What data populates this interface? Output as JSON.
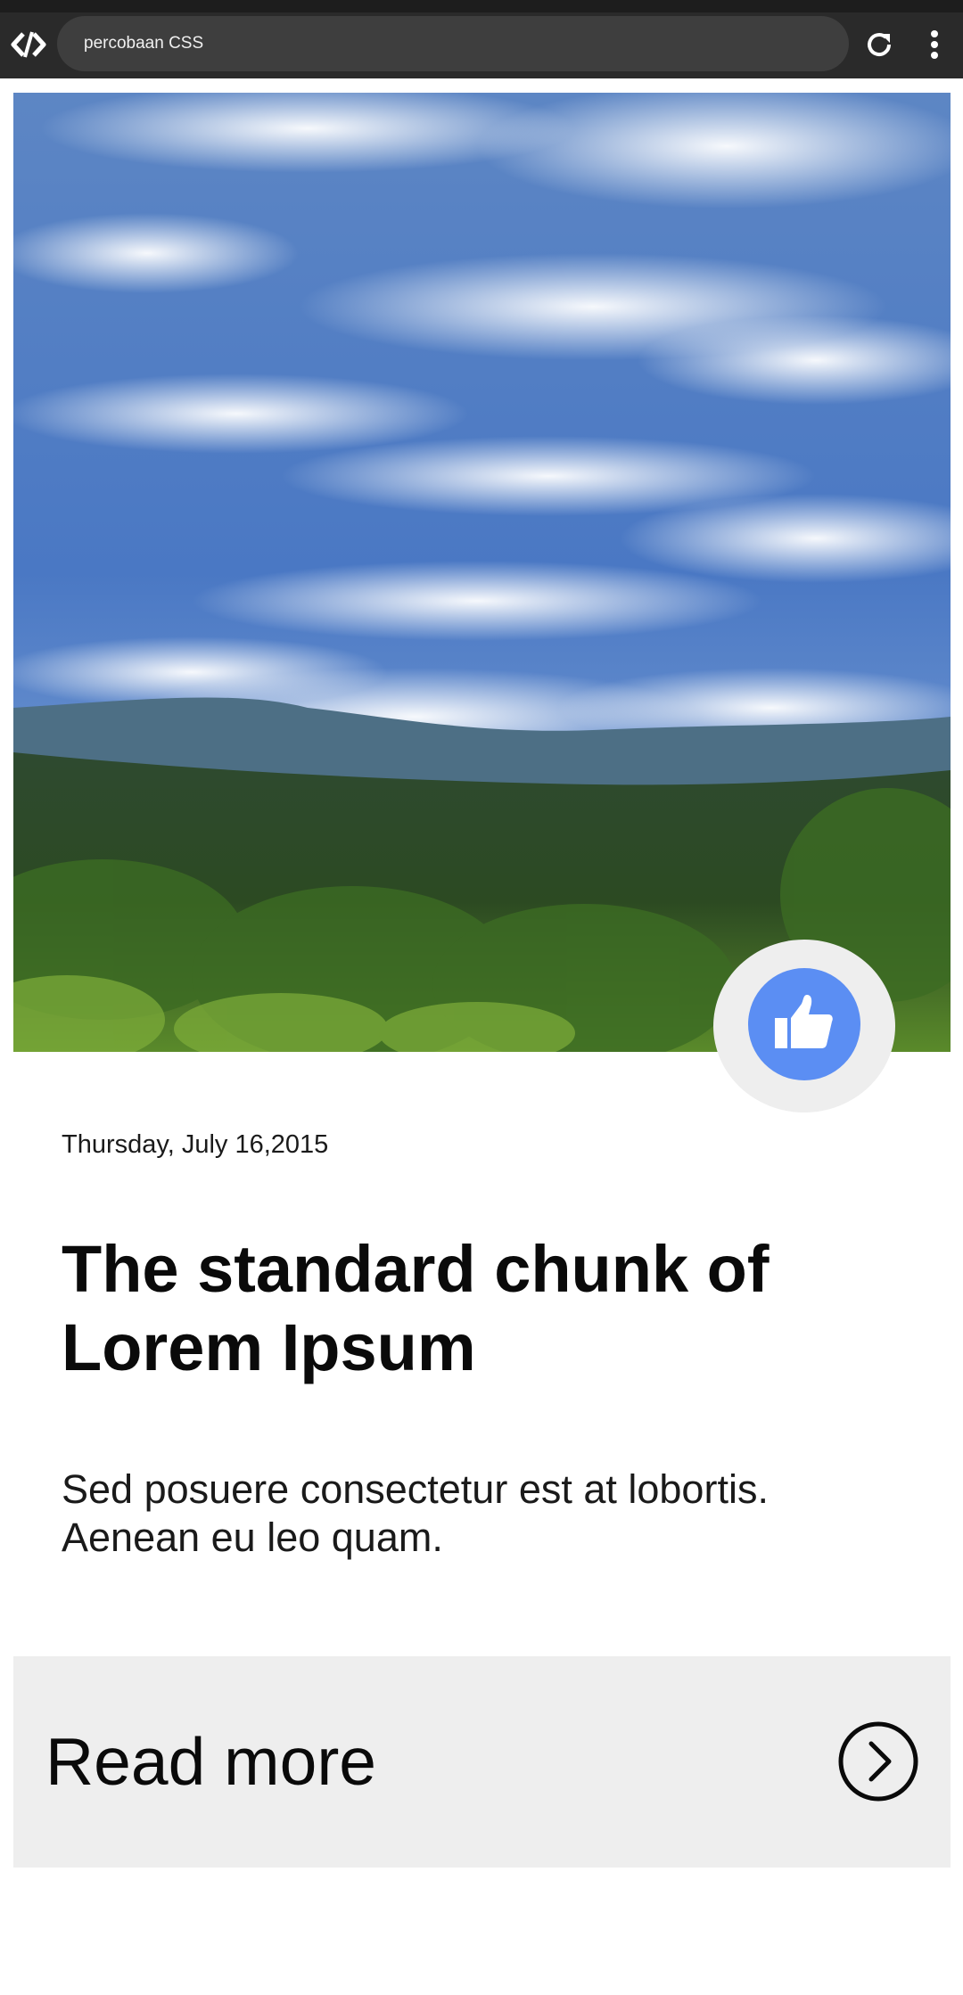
{
  "browser": {
    "url_text": "percobaan CSS",
    "logo_icon": "code-brackets-icon",
    "reload_icon": "reload-icon",
    "menu_icon": "vertical-dots-icon"
  },
  "hero": {
    "image_subject": "landscape-sky-mountains-forest",
    "like_icon": "thumbs-up-icon",
    "like_color": "#5b8ef3"
  },
  "post": {
    "date": "Thursday, July 16,2015",
    "title": "The standard chunk of Lorem Ipsum",
    "excerpt": "Sed posuere consectetur est at lobortis. Aenean eu leo quam."
  },
  "read_more": {
    "label": "Read more",
    "icon": "chevron-right-circle-icon"
  },
  "colors": {
    "topbar": "#2a2a2a",
    "url_bar": "#3e3e3e",
    "panel": "#eeeeee",
    "accent": "#5b8ef3"
  }
}
